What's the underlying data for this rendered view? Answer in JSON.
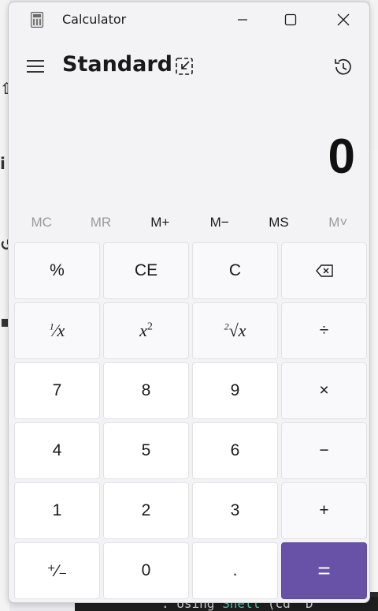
{
  "background": {
    "bottom_text_prefix": ": Using ",
    "bottom_text_kw": "Shell",
    "bottom_text_suffix": " (cd \"D"
  },
  "window": {
    "title": "Calculator",
    "minimize_icon": "minimize-icon",
    "maximize_icon": "maximize-icon",
    "close_icon": "close-icon"
  },
  "header": {
    "mode": "Standard",
    "menu_icon": "hamburger-icon",
    "keep_on_top_icon": "keep-on-top-icon",
    "history_icon": "history-icon"
  },
  "display": {
    "value": "0"
  },
  "memory": [
    {
      "label": "MC",
      "enabled": false,
      "name": "memory-clear-button"
    },
    {
      "label": "MR",
      "enabled": false,
      "name": "memory-recall-button"
    },
    {
      "label": "M+",
      "enabled": true,
      "name": "memory-add-button"
    },
    {
      "label": "M−",
      "enabled": true,
      "name": "memory-subtract-button"
    },
    {
      "label": "MS",
      "enabled": true,
      "name": "memory-store-button"
    },
    {
      "label": "M˅",
      "enabled": false,
      "name": "memory-list-button"
    }
  ],
  "keys": {
    "percent": "%",
    "clear_entry": "CE",
    "clear": "C",
    "reciprocal_num": "1",
    "reciprocal_den": "x",
    "square_base": "x",
    "square_exp": "2",
    "sqrt_index": "2",
    "sqrt_x": "x",
    "divide": "÷",
    "seven": "7",
    "eight": "8",
    "nine": "9",
    "multiply": "×",
    "four": "4",
    "five": "5",
    "six": "6",
    "subtract": "−",
    "one": "1",
    "two": "2",
    "three": "3",
    "add": "+",
    "negate": "⁺∕₋",
    "zero": "0",
    "decimal": ".",
    "equals": "="
  },
  "colors": {
    "accent": "#6752a8",
    "window_bg": "#f3f3f6"
  }
}
